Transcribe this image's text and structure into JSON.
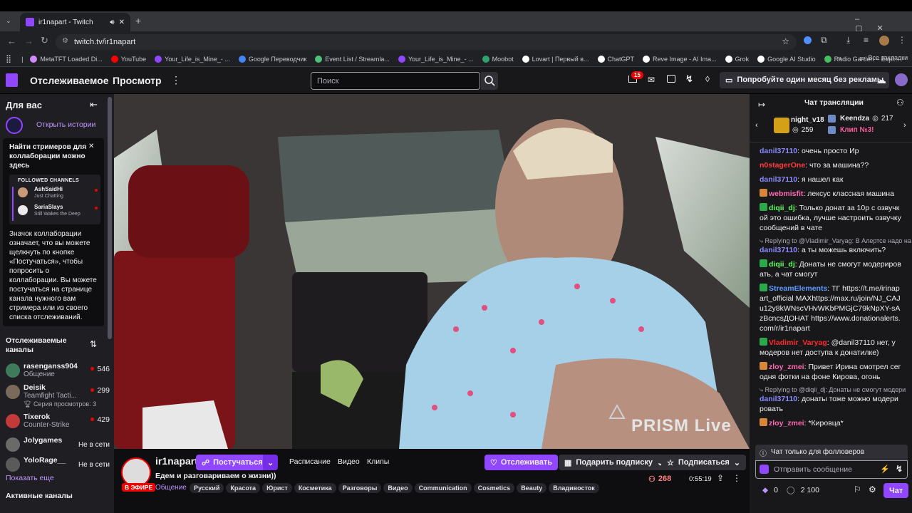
{
  "browser": {
    "tab_title": "ir1napart - Twitch",
    "url": "twitch.tv/ir1napart",
    "bookmarks": [
      "MetaTFT Loaded Di...",
      "YouTube",
      "Your_Life_is_Mine_- ...",
      "Google Переводчик",
      "Event List / Streamla...",
      "Your_Life_is_Mine_- ...",
      "Moobot",
      "Lovart | Первый в...",
      "ChatGPT",
      "Reve Image - AI Ima...",
      "Grok",
      "Google AI Studio",
      "Radio Garden – Expl..."
    ],
    "all_bookmarks": "Все закладки"
  },
  "twitch_nav": {
    "following": "Отслеживаемое",
    "browse": "Просмотр",
    "search_placeholder": "Поиск",
    "notif_count": "15",
    "promo": "Попробуйте один месяц без рекламы"
  },
  "sidebar": {
    "for_you": "Для вас",
    "open_stories": "Открыть истории",
    "collab_title": "Найти стримеров для коллаборации можно здесь",
    "followed_channels_label": "FOLLOWED CHANNELS",
    "mini_channels": [
      {
        "name": "AshSaidHi",
        "game": "Just Chatting"
      },
      {
        "name": "SariaSlays",
        "game": "Still Wakes the Deep"
      }
    ],
    "collab_text": "Значок коллаборации означает, что вы можете щелкнуть по кнопке «Постучаться», чтобы попросить о коллаборации. Вы можете постучаться на странице канала нужного вам стримера или из своего списка отслеживаний.",
    "followed_title": "Отслеживаемые каналы",
    "channels": [
      {
        "name": "rasenganss904",
        "game": "Общение",
        "viewers": "546",
        "extra": "",
        "live": true
      },
      {
        "name": "Deisik",
        "game": "Teamfight Tacti...",
        "viewers": "299",
        "extra": "Серия просмотров: 3",
        "live": true
      },
      {
        "name": "Tixerok",
        "game": "Counter-Strike",
        "viewers": "429",
        "extra": "",
        "live": true
      },
      {
        "name": "Jolygames",
        "game": "",
        "viewers": "Не в сети",
        "extra": "",
        "live": false
      },
      {
        "name": "YoloRage__",
        "game": "",
        "viewers": "Не в сети",
        "extra": "",
        "live": false
      }
    ],
    "show_more": "Показать еще",
    "active_channels": "Активные каналы"
  },
  "video": {
    "watermark": "PRISM Live"
  },
  "stream_info": {
    "channel": "ir1napart",
    "live_badge": "В ЭФИРЕ",
    "knock": "Постучаться",
    "tabs": [
      "Расписание",
      "Видео",
      "Клипы"
    ],
    "follow": "Отслеживать",
    "gift_sub": "Подарить подписку",
    "subscribe": "Подписаться",
    "title": "Едем и разговариваем о жизни))",
    "category": "Общение",
    "tags": [
      "Русский",
      "Красота",
      "Юрист",
      "Косметика",
      "Разговоры",
      "Видео",
      "Communication",
      "Cosmetics",
      "Beauty",
      "Владивосток"
    ],
    "viewers": "268",
    "uptime": "0:55:19"
  },
  "chat": {
    "title": "Чат трансляции",
    "carousel": {
      "user1": "night_v18",
      "user1_count": "259",
      "user2": "Keendza",
      "user2_count": "217",
      "clip": "Клип №3!"
    },
    "messages": [
      {
        "reply": "",
        "user": "danil37110",
        "color": "#8a8aff",
        "text": "очень просто Ир"
      },
      {
        "reply": "",
        "user": "n0stagerOne",
        "color": "#ff3b3b",
        "text": "что за машина??"
      },
      {
        "reply": "",
        "user": "danil37110",
        "color": "#8a8aff",
        "text": "я нашел как"
      },
      {
        "reply": "",
        "user": "webmisfit",
        "color": "#ff69b4",
        "text": "лексус классная машина"
      },
      {
        "reply": "",
        "user": "diqii_dj",
        "color": "#5cff5c",
        "text": "Только донат за 10р с озвучкой это ошибка, лучше настроить озвучку сообщений в чате"
      },
      {
        "reply": "Replying to @Vladimir_Varyag: В Алертсе надо на",
        "user": "danil37110",
        "color": "#8a8aff",
        "text": "а ты можешь включить?"
      },
      {
        "reply": "",
        "user": "diqii_dj",
        "color": "#5cff5c",
        "text": "Донаты не смогут модерировать, а чат смогут"
      },
      {
        "reply": "",
        "user": "StreamElements",
        "color": "#5c9dff",
        "text": "ТГ https://t.me/irinapart_official МАXhttps://max.ru/join/NJ_CAJu12y8kWNscVHvWKbPMGjC79kNpXY-sAzBcncsДОНАТ https://www.donationalerts.com/r/ir1napart"
      },
      {
        "reply": "",
        "user": "Vladimir_Varyag",
        "color": "#ff2a2a",
        "text": "@danil37110 нет, у модеров нет доступа к донатилке)"
      },
      {
        "reply": "",
        "user": "zloy_zmei",
        "color": "#ff69b4",
        "text": "Привет Ирина смотрел сегодня фотки на фоне Кирова, огонь"
      },
      {
        "reply": "Replying to @diqii_dj: Донаты не смогут модери",
        "user": "danil37110",
        "color": "#8a8aff",
        "text": "донаты тоже можно модерировать"
      },
      {
        "reply": "",
        "user": "zloy_zmei",
        "color": "#ff69b4",
        "text": "*Кировца*"
      }
    ],
    "followers_only": "Чат только для фолловеров",
    "send_placeholder": "Отправить сообщение",
    "bits": "0",
    "points": "2 100",
    "chat_button": "Чат"
  }
}
